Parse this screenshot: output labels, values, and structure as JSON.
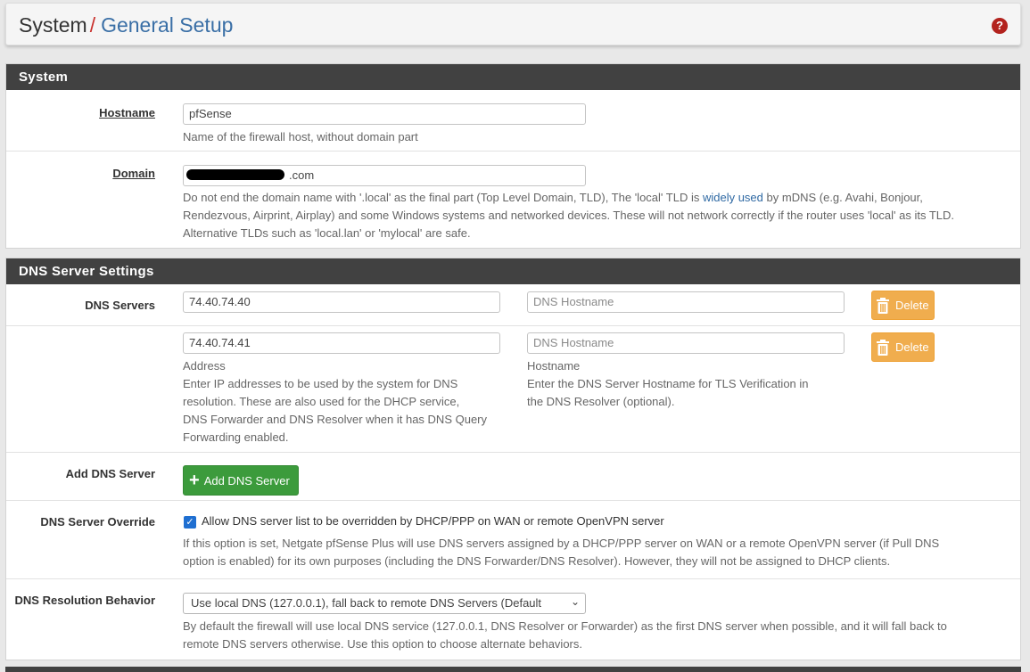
{
  "breadcrumb": {
    "root": "System",
    "separator": "/",
    "current": "General Setup"
  },
  "system_panel": {
    "title": "System",
    "hostname": {
      "label": "Hostname",
      "value": "pfSense",
      "help": "Name of the firewall host, without domain part"
    },
    "domain": {
      "label": "Domain",
      "value": ".com",
      "help_lines": [
        "Do not end the domain name with '.local' as the final part (Top Level Domain, TLD), The 'local' TLD is",
        "widely used",
        "by mDNS (e.g. Avahi, Bonjour,",
        "Rendezvous, Airprint, Airplay) and some Windows systems and networked devices. These will not network correctly if the router uses 'local' as its TLD.",
        "Alternative TLDs such as 'local.lan' or 'mylocal' are safe."
      ]
    }
  },
  "dns_panel": {
    "title": "DNS Server Settings",
    "servers_label": "DNS Servers",
    "servers": [
      {
        "address": "74.40.74.40",
        "hostname_placeholder": "DNS Hostname",
        "delete_label": "Delete"
      },
      {
        "address": "74.40.74.41",
        "hostname_placeholder": "DNS Hostname",
        "delete_label": "Delete"
      }
    ],
    "address_help_title": "Address",
    "address_help_lines": [
      "Enter IP addresses to be used by the system for DNS",
      "resolution. These are also used for the DHCP service,",
      "DNS Forwarder and DNS Resolver when it has DNS Query",
      "Forwarding enabled."
    ],
    "hostname_help_title": "Hostname",
    "hostname_help_lines": [
      "Enter the DNS Server Hostname for TLS Verification in",
      "the DNS Resolver (optional)."
    ],
    "add_label": "Add DNS Server",
    "add_button": "Add DNS Server",
    "override_label": "DNS Server Override",
    "override_checked": true,
    "override_checkbox_text": "Allow DNS server list to be overridden by DHCP/PPP on WAN or remote OpenVPN server",
    "override_help_lines": [
      "If this option is set, Netgate pfSense Plus will use DNS servers assigned by a DHCP/PPP server on WAN or a remote OpenVPN server (if Pull DNS",
      "option is enabled) for its own purposes (including the DNS Forwarder/DNS Resolver). However, they will not be assigned to DHCP clients."
    ],
    "resolution_label": "DNS Resolution Behavior",
    "resolution_selected": "Use local DNS (127.0.0.1), fall back to remote DNS Servers (Default",
    "resolution_help_lines": [
      "By default the firewall will use local DNS service (127.0.0.1, DNS Resolver or Forwarder) as the first DNS server when possible, and it will fall back to",
      "remote DNS servers otherwise. Use this option to choose alternate behaviors."
    ]
  },
  "colors": {
    "panel_header": "#414141",
    "link": "#2f69a3",
    "delete_button": "#f0ad4e",
    "add_button": "#3c9b3c",
    "help_icon": "#b3231e"
  },
  "icons": [
    "help-icon",
    "trash-icon",
    "plus-icon",
    "checkbox-checked-icon",
    "chevron-down-icon"
  ]
}
